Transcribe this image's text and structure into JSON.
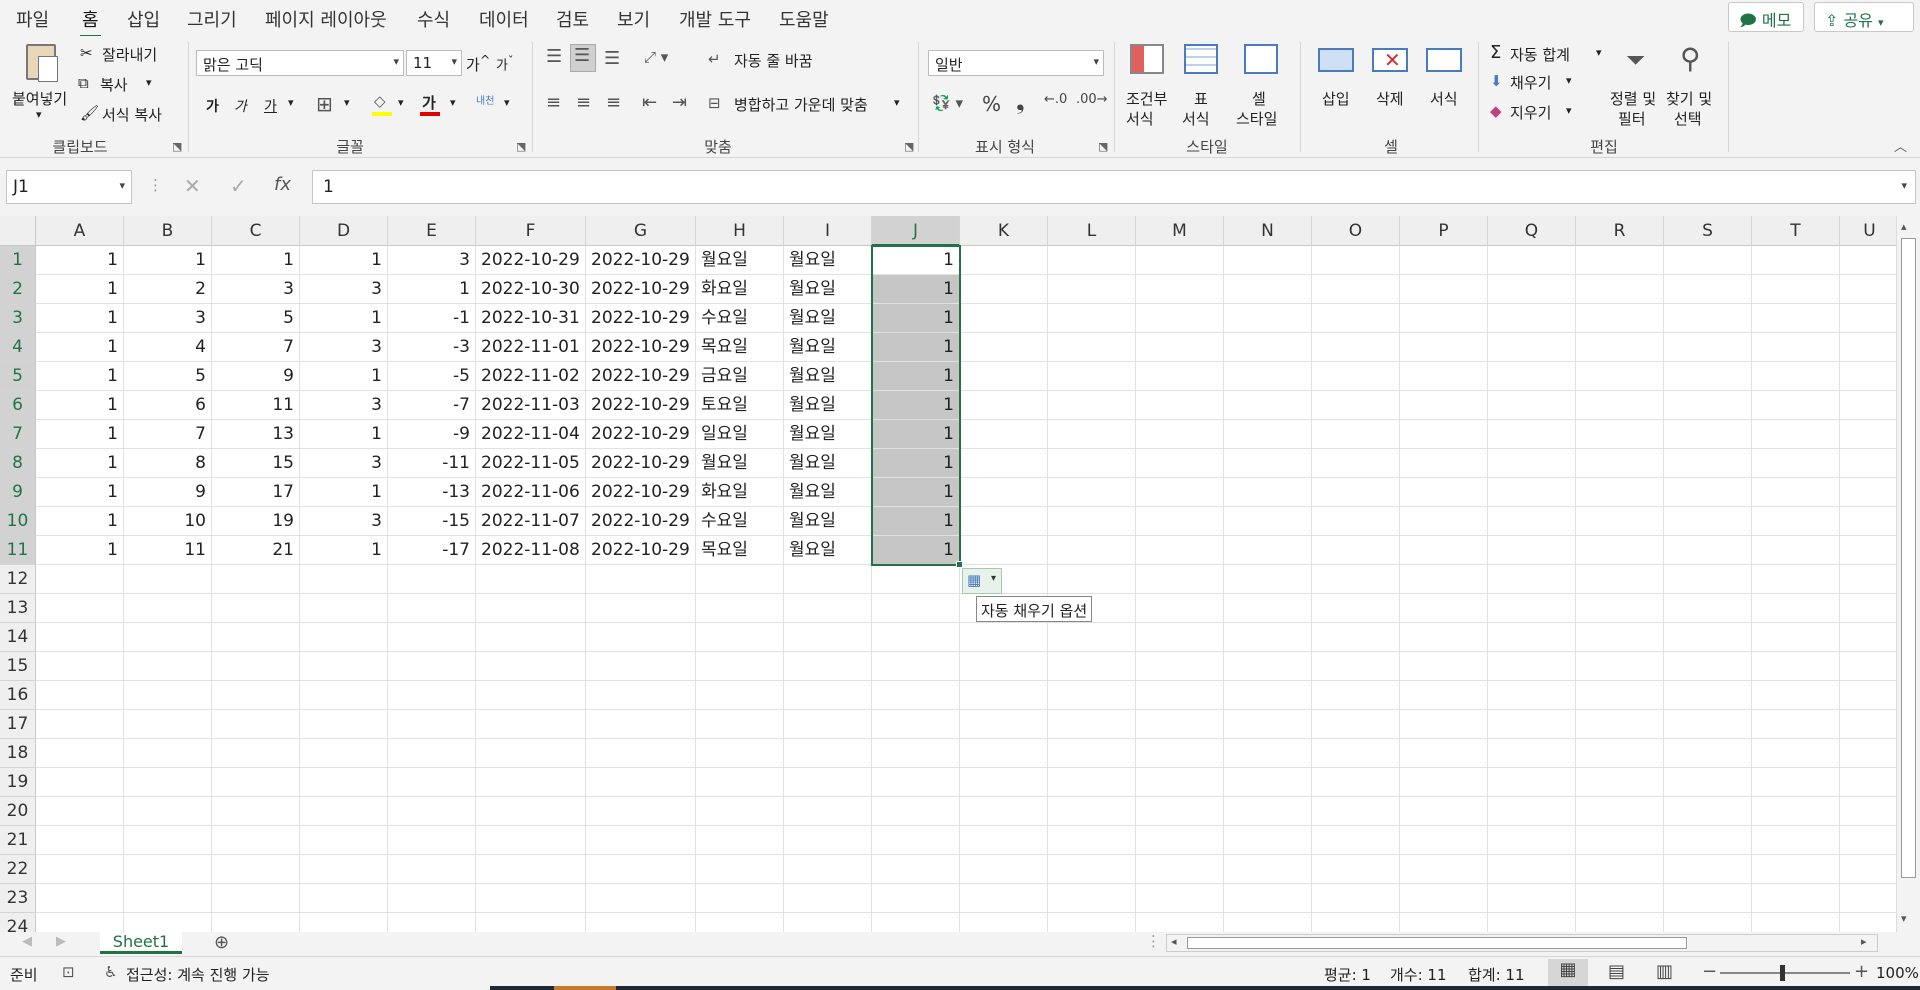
{
  "menu": {
    "tabs": [
      "파일",
      "홈",
      "삽입",
      "그리기",
      "페이지 레이아웃",
      "수식",
      "데이터",
      "검토",
      "보기",
      "개발 도구",
      "도움말"
    ],
    "active_tab": "홈",
    "memo_label": "메모",
    "share_label": "공유"
  },
  "ribbon": {
    "clipboard": {
      "paste": "붙여넣기",
      "cut": "잘라내기",
      "copy": "복사",
      "format_painter": "서식 복사",
      "group": "클립보드"
    },
    "font": {
      "name": "맑은 고딕",
      "size": "11",
      "group": "글꼴",
      "bold": "가",
      "italic": "가",
      "underline": "가",
      "grow": "가",
      "shrink": "가",
      "phonetic": "내천"
    },
    "alignment": {
      "wrap": "자동 줄 바꿈",
      "merge": "병합하고 가운데 맞춤",
      "group": "맞춤"
    },
    "number": {
      "format": "일반",
      "group": "표시 형식"
    },
    "styles": {
      "conditional_line1": "조건부",
      "conditional_line2": "서식",
      "table_line1": "표",
      "table_line2": "서식",
      "cell_line1": "셀",
      "cell_line2": "스타일",
      "group": "스타일"
    },
    "cells": {
      "insert": "삽입",
      "delete": "삭제",
      "format": "서식",
      "group": "셀"
    },
    "editing": {
      "autosum": "자동 합계",
      "fill": "채우기",
      "clear": "지우기",
      "sort_line1": "정렬 및",
      "sort_line2": "필터",
      "find_line1": "찾기 및",
      "find_line2": "선택",
      "group": "편집"
    }
  },
  "formula": {
    "namebox": "J1",
    "fx": "fx",
    "value": "1"
  },
  "columns": [
    "A",
    "B",
    "C",
    "D",
    "E",
    "F",
    "G",
    "H",
    "I",
    "J",
    "K",
    "L",
    "M",
    "N",
    "O",
    "P",
    "Q",
    "R",
    "S",
    "T",
    "U"
  ],
  "selected_column": "J",
  "row_count": 24,
  "rows": [
    [
      "1",
      "1",
      "1",
      "1",
      "3",
      "2022-10-29",
      "2022-10-29",
      "월요일",
      "월요일",
      "1"
    ],
    [
      "1",
      "2",
      "3",
      "3",
      "1",
      "2022-10-30",
      "2022-10-29",
      "화요일",
      "월요일",
      "1"
    ],
    [
      "1",
      "3",
      "5",
      "1",
      "-1",
      "2022-10-31",
      "2022-10-29",
      "수요일",
      "월요일",
      "1"
    ],
    [
      "1",
      "4",
      "7",
      "3",
      "-3",
      "2022-11-01",
      "2022-10-29",
      "목요일",
      "월요일",
      "1"
    ],
    [
      "1",
      "5",
      "9",
      "1",
      "-5",
      "2022-11-02",
      "2022-10-29",
      "금요일",
      "월요일",
      "1"
    ],
    [
      "1",
      "6",
      "11",
      "3",
      "-7",
      "2022-11-03",
      "2022-10-29",
      "토요일",
      "월요일",
      "1"
    ],
    [
      "1",
      "7",
      "13",
      "1",
      "-9",
      "2022-11-04",
      "2022-10-29",
      "일요일",
      "월요일",
      "1"
    ],
    [
      "1",
      "8",
      "15",
      "3",
      "-11",
      "2022-11-05",
      "2022-10-29",
      "월요일",
      "월요일",
      "1"
    ],
    [
      "1",
      "9",
      "17",
      "1",
      "-13",
      "2022-11-06",
      "2022-10-29",
      "화요일",
      "월요일",
      "1"
    ],
    [
      "1",
      "10",
      "19",
      "3",
      "-15",
      "2022-11-07",
      "2022-10-29",
      "수요일",
      "월요일",
      "1"
    ],
    [
      "1",
      "11",
      "21",
      "1",
      "-17",
      "2022-11-08",
      "2022-10-29",
      "목요일",
      "월요일",
      "1"
    ]
  ],
  "autofill_tooltip": "자동 채우기 옵션",
  "sheet": {
    "tab": "Sheet1"
  },
  "status": {
    "ready": "준비",
    "accessibility": "접근성: 계속 진행 가능",
    "average": "평균: 1",
    "count": "개수: 11",
    "sum": "합계: 11",
    "zoom": "100%"
  },
  "colors": {
    "accent": "#217346",
    "selection": "#c6c6c6"
  }
}
